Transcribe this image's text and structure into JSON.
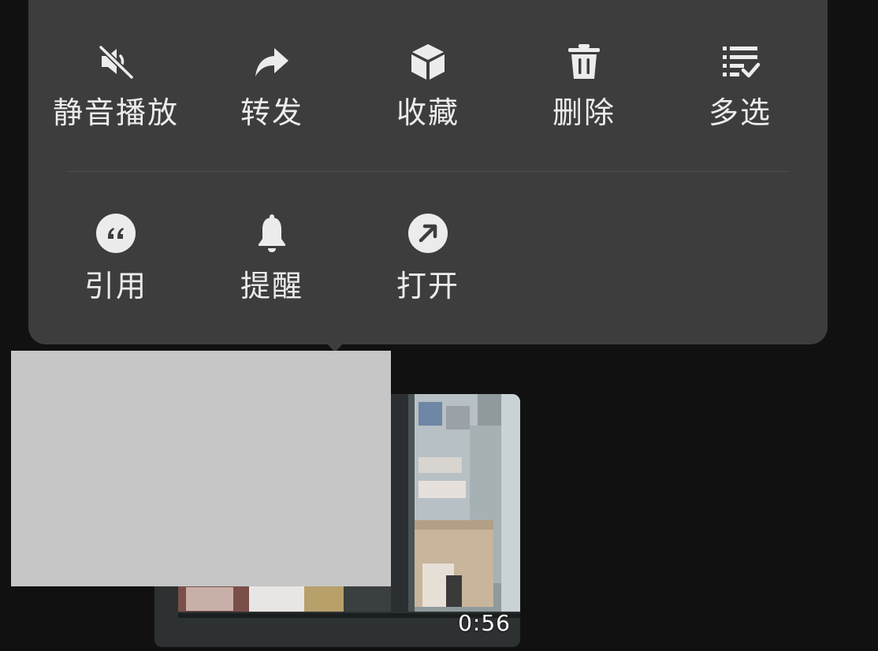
{
  "menu": {
    "row1": [
      {
        "label": "静音播放",
        "icon": "mute-speaker-icon"
      },
      {
        "label": "转发",
        "icon": "forward-arrow-icon"
      },
      {
        "label": "收藏",
        "icon": "cube-box-icon"
      },
      {
        "label": "删除",
        "icon": "trash-can-icon"
      },
      {
        "label": "多选",
        "icon": "list-check-icon"
      }
    ],
    "row2": [
      {
        "label": "引用",
        "icon": "quote-icon"
      },
      {
        "label": "提醒",
        "icon": "bell-icon"
      },
      {
        "label": "打开",
        "icon": "open-arrow-icon"
      }
    ]
  },
  "video": {
    "duration": "0:56"
  },
  "colors": {
    "background": "#111111",
    "menu_bg": "#3d3d3d",
    "menu_text": "#ececec",
    "redaction": "#c6c6c6"
  }
}
